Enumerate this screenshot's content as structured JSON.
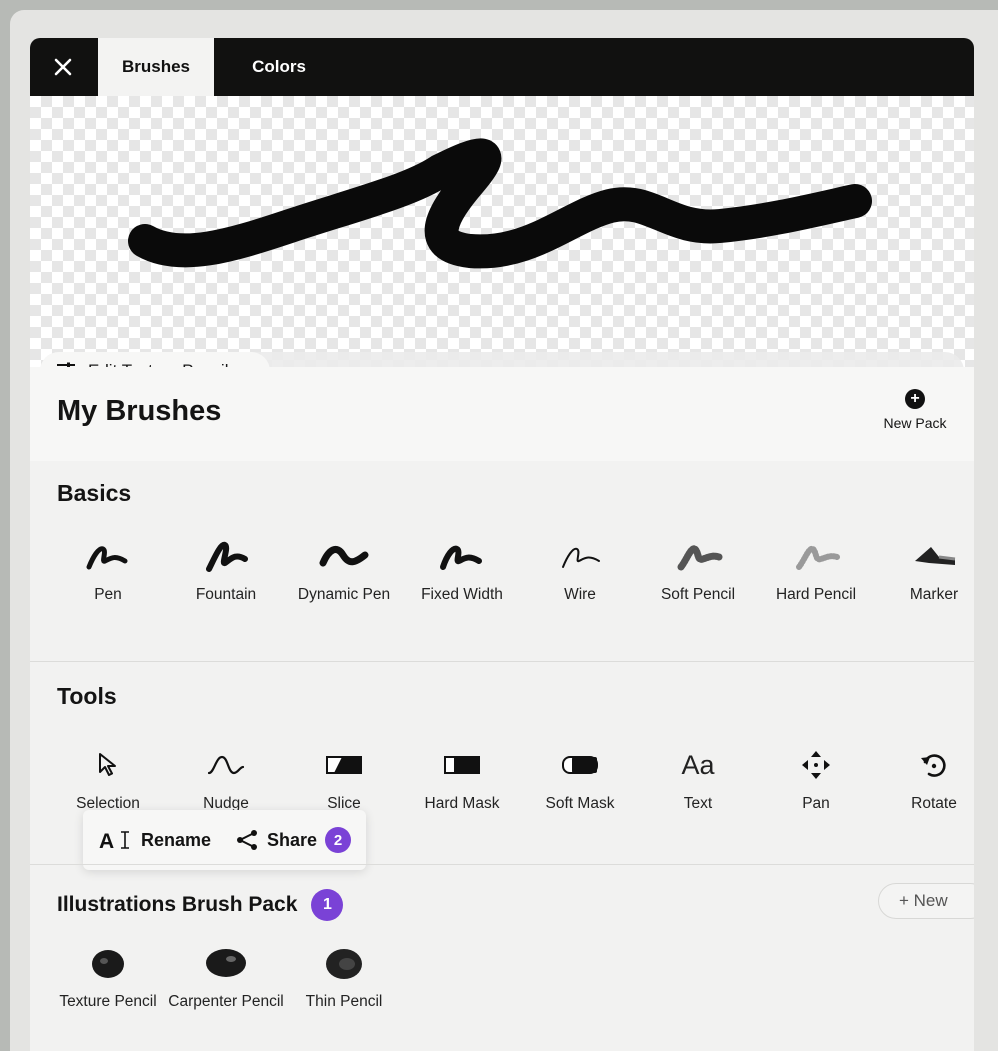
{
  "tabs": {
    "brushes": "Brushes",
    "colors": "Colors"
  },
  "preview": {
    "edit_label": "Edit Texture Pencil"
  },
  "header": {
    "title": "My Brushes",
    "new_pack_label": "New Pack"
  },
  "basics": {
    "title": "Basics",
    "items": [
      {
        "label": "Pen",
        "icon": "pen-stroke-icon"
      },
      {
        "label": "Fountain",
        "icon": "fountain-stroke-icon"
      },
      {
        "label": "Dynamic Pen",
        "icon": "dynamic-pen-stroke-icon"
      },
      {
        "label": "Fixed Width",
        "icon": "fixed-width-stroke-icon"
      },
      {
        "label": "Wire",
        "icon": "wire-stroke-icon"
      },
      {
        "label": "Soft Pencil",
        "icon": "soft-pencil-stroke-icon"
      },
      {
        "label": "Hard Pencil",
        "icon": "hard-pencil-stroke-icon"
      },
      {
        "label": "Marker",
        "icon": "marker-stroke-icon"
      }
    ]
  },
  "tools": {
    "title": "Tools",
    "items": [
      {
        "label": "Selection",
        "icon": "cursor-icon"
      },
      {
        "label": "Nudge",
        "icon": "nudge-icon"
      },
      {
        "label": "Slice",
        "icon": "slice-icon"
      },
      {
        "label": "Hard Mask",
        "icon": "hard-mask-icon"
      },
      {
        "label": "Soft Mask",
        "icon": "soft-mask-icon"
      },
      {
        "label": "Text",
        "icon": "text-icon",
        "glyph": "Aa"
      },
      {
        "label": "Pan",
        "icon": "pan-arrows-icon"
      },
      {
        "label": "Rotate",
        "icon": "rotate-icon"
      }
    ]
  },
  "popup": {
    "rename": "Rename",
    "share": "Share",
    "share_badge": "2"
  },
  "pack": {
    "title": "Illustrations Brush Pack",
    "badge": "1",
    "new_button": "+ New",
    "items": [
      {
        "label": "Texture Pencil",
        "icon": "texture-pencil-blob-icon"
      },
      {
        "label": "Carpenter Pencil",
        "icon": "carpenter-pencil-blob-icon"
      },
      {
        "label": "Thin Pencil",
        "icon": "thin-pencil-blob-icon"
      }
    ]
  },
  "colors": {
    "badge": "#7a42d6",
    "topbar": "#111110"
  }
}
